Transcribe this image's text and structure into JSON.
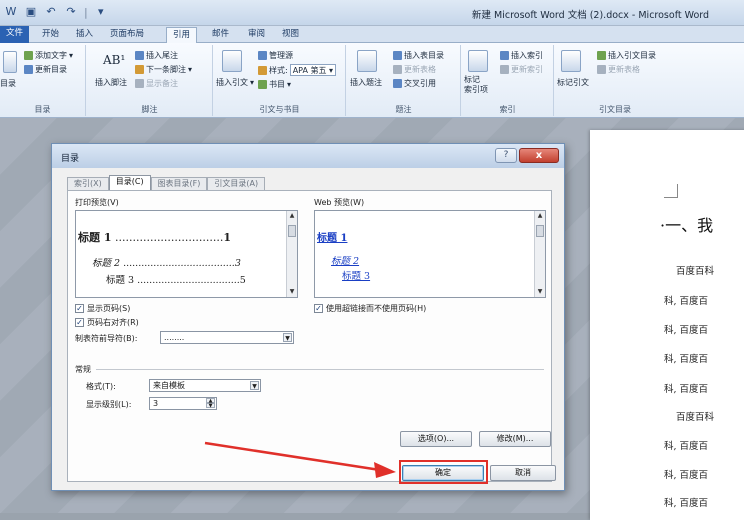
{
  "window": {
    "title": "新建 Microsoft Word 文档 (2).docx - Microsoft Word"
  },
  "qat": {
    "icons": [
      "word-icon",
      "save-icon",
      "undo-icon",
      "redo-icon",
      "customize-icon"
    ]
  },
  "tabs": [
    {
      "label": "文件"
    },
    {
      "label": "开始"
    },
    {
      "label": "插入"
    },
    {
      "label": "页面布局"
    },
    {
      "label": "引用"
    },
    {
      "label": "邮件"
    },
    {
      "label": "审阅"
    },
    {
      "label": "视图"
    }
  ],
  "ribbon": {
    "toc_group": {
      "big_button": "目录",
      "add_text": "添加文字",
      "update_toc": "更新目录",
      "label": "目录"
    },
    "footnote_group": {
      "insert_footnote": "插入脚注",
      "insert_endnote": "插入尾注",
      "next_footnote": "下一条脚注",
      "show_notes": "显示备注",
      "label": "脚注"
    },
    "citation_group": {
      "insert_citation": "插入引文",
      "manage_sources": "管理源",
      "style_label": "样式:",
      "style_value": "APA 第五",
      "bibliography": "书目",
      "label": "引文与书目"
    },
    "caption_group": {
      "insert_caption": "插入题注",
      "insert_table_of_figures": "插入表目录",
      "update_table": "更新表格",
      "cross_reference": "交叉引用",
      "label": "题注"
    },
    "index_group": {
      "mark_entry": "标记\n索引项",
      "insert_index": "插入索引",
      "update_index": "更新索引",
      "label": "索引"
    },
    "toa_group": {
      "mark_citation": "标记引文",
      "insert_toa": "插入引文目录",
      "update_table": "更新表格",
      "label": "引文目录"
    }
  },
  "dialog": {
    "title": "目录",
    "help": "?",
    "close": "x",
    "tabs": [
      {
        "label": "索引(X)"
      },
      {
        "label": "目录(C)"
      },
      {
        "label": "图表目录(F)"
      },
      {
        "label": "引文目录(A)"
      }
    ],
    "print_preview": {
      "label": "打印预览(V)",
      "lines": [
        {
          "text": "标题 1",
          "page": "1"
        },
        {
          "text": "标题 2",
          "page": "3"
        },
        {
          "text": "标题 3",
          "page": "5"
        }
      ]
    },
    "web_preview": {
      "label": "Web 预览(W)",
      "lines": [
        "标题 1",
        "标题 2",
        "标题 3"
      ]
    },
    "options": {
      "show_page_numbers": "显示页码(S)",
      "right_align": "页码右对齐(R)",
      "tab_leader_label": "制表符前导符(B):",
      "tab_leader_value": "........",
      "use_hyperlinks": "使用超链接而不使用页码(H)"
    },
    "general": {
      "label": "常规",
      "format_label": "格式(T):",
      "format_value": "来自模板",
      "levels_label": "显示级别(L):",
      "levels_value": "3"
    },
    "buttons": {
      "options": "选项(O)...",
      "modify": "修改(M)...",
      "ok": "确定",
      "cancel": "取消"
    }
  },
  "document": {
    "heading": "·一、我",
    "lines": [
      "百度百科",
      "科, 百度百",
      "科, 百度百",
      "科, 百度百",
      "科, 百度百",
      "百度百科",
      "科, 百度百",
      "科, 百度百",
      "科, 百度百"
    ]
  },
  "annotation": {
    "highlight_color": "#e0302a"
  }
}
